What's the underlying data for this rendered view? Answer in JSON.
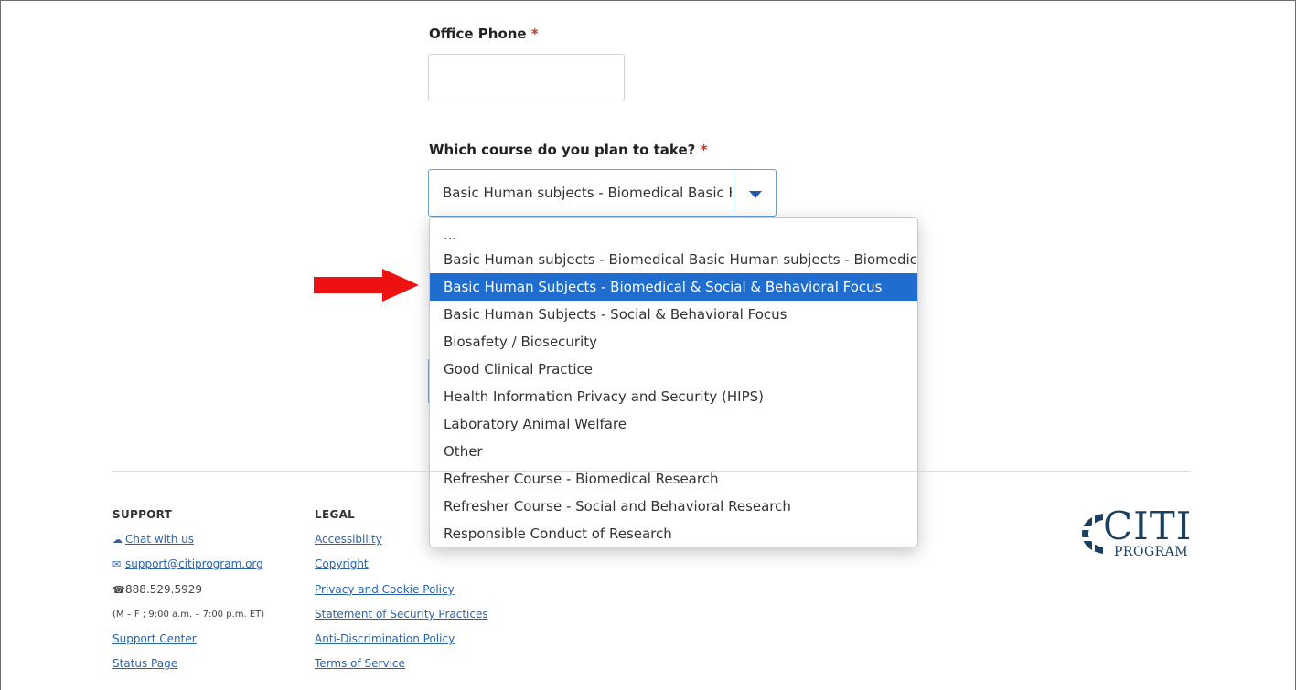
{
  "form": {
    "office_phone": {
      "label": "Office Phone",
      "required_mark": "*",
      "value": ""
    },
    "course": {
      "label": "Which course do you plan to take?",
      "required_mark": "*",
      "selected_display": "Basic Human subjects - Biomedical Basic H",
      "options": [
        "...",
        "Basic Human subjects - Biomedical Basic Human subjects - Biomedica",
        "Basic Human Subjects - Biomedical & Social & Behavioral Focus",
        "Basic Human Subjects - Social & Behavioral Focus",
        "Biosafety / Biosecurity",
        "Good Clinical Practice",
        "Health Information Privacy and Security (HIPS)",
        "Laboratory Animal Welfare",
        "Other",
        "Refresher Course - Biomedical Research",
        "Refresher Course - Social and Behavioral Research",
        "Responsible Conduct of Research"
      ],
      "highlighted_option_index": 2
    }
  },
  "annotation": {
    "arrow_color": "#ee1111"
  },
  "footer": {
    "support": {
      "heading": "SUPPORT",
      "chat": "Chat with us",
      "email": "support@citiprogram.org",
      "phone": "888.529.5929",
      "hours": "(M – F ; 9:00 a.m. – 7:00 p.m. ET)",
      "support_center": "Support Center",
      "status_page": "Status Page"
    },
    "legal": {
      "heading": "LEGAL",
      "links": [
        "Accessibility",
        "Copyright",
        "Privacy and Cookie Policy",
        "Statement of Security Practices",
        "Anti-Discrimination Policy",
        "Terms of Service"
      ]
    },
    "logo": {
      "main": "CITI",
      "sub": "PROGRAM"
    }
  },
  "colors": {
    "accent": "#1e6dcf",
    "link": "#2a63a7",
    "required": "#c0392b",
    "logo": "#1b3f5e"
  }
}
